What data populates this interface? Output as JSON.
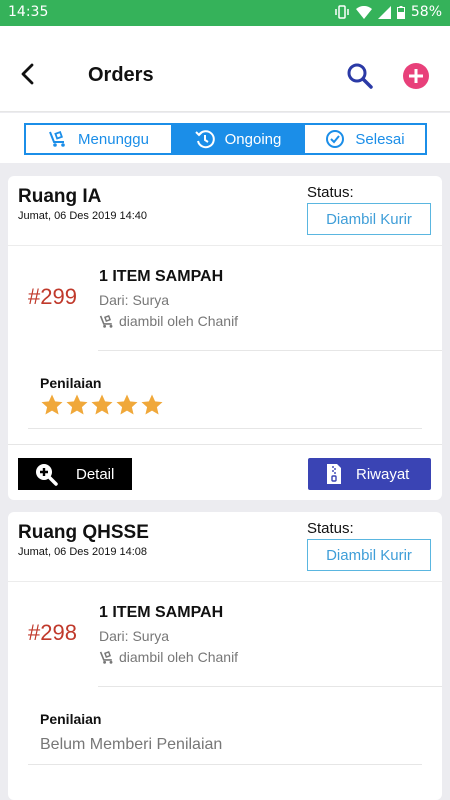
{
  "status_bar": {
    "time": "14:35",
    "battery": "58%"
  },
  "header": {
    "title": "Orders"
  },
  "tabs": [
    {
      "label": "Menunggu",
      "icon": "cart-icon"
    },
    {
      "label": "Ongoing",
      "icon": "history-icon"
    },
    {
      "label": "Selesai",
      "icon": "check-circle-icon"
    }
  ],
  "colors": {
    "statusbar": "#35b25a",
    "accent": "#1b8ee8",
    "order_no": "#c0392b",
    "riwayat": "#3a44b4",
    "star": "#f0a83a",
    "add": "#e8407a"
  },
  "orders": [
    {
      "room": "Ruang IA",
      "date": "Jumat, 06 Des 2019 14:40",
      "status_label": "Status:",
      "status": "Diambil Kurir",
      "order_no": "#299",
      "item": "1 ITEM SAMPAH",
      "from": "Dari: Surya",
      "courier": "diambil oleh Chanif",
      "rating_label": "Penilaian",
      "rating": 5,
      "detail_label": "Detail",
      "history_label": "Riwayat"
    },
    {
      "room": "Ruang QHSSE",
      "date": "Jumat, 06 Des 2019 14:08",
      "status_label": "Status:",
      "status": "Diambil Kurir",
      "order_no": "#298",
      "item": "1 ITEM SAMPAH",
      "from": "Dari: Surya",
      "courier": "diambil oleh Chanif",
      "rating_label": "Penilaian",
      "rating_text": "Belum Memberi Penilaian"
    }
  ]
}
